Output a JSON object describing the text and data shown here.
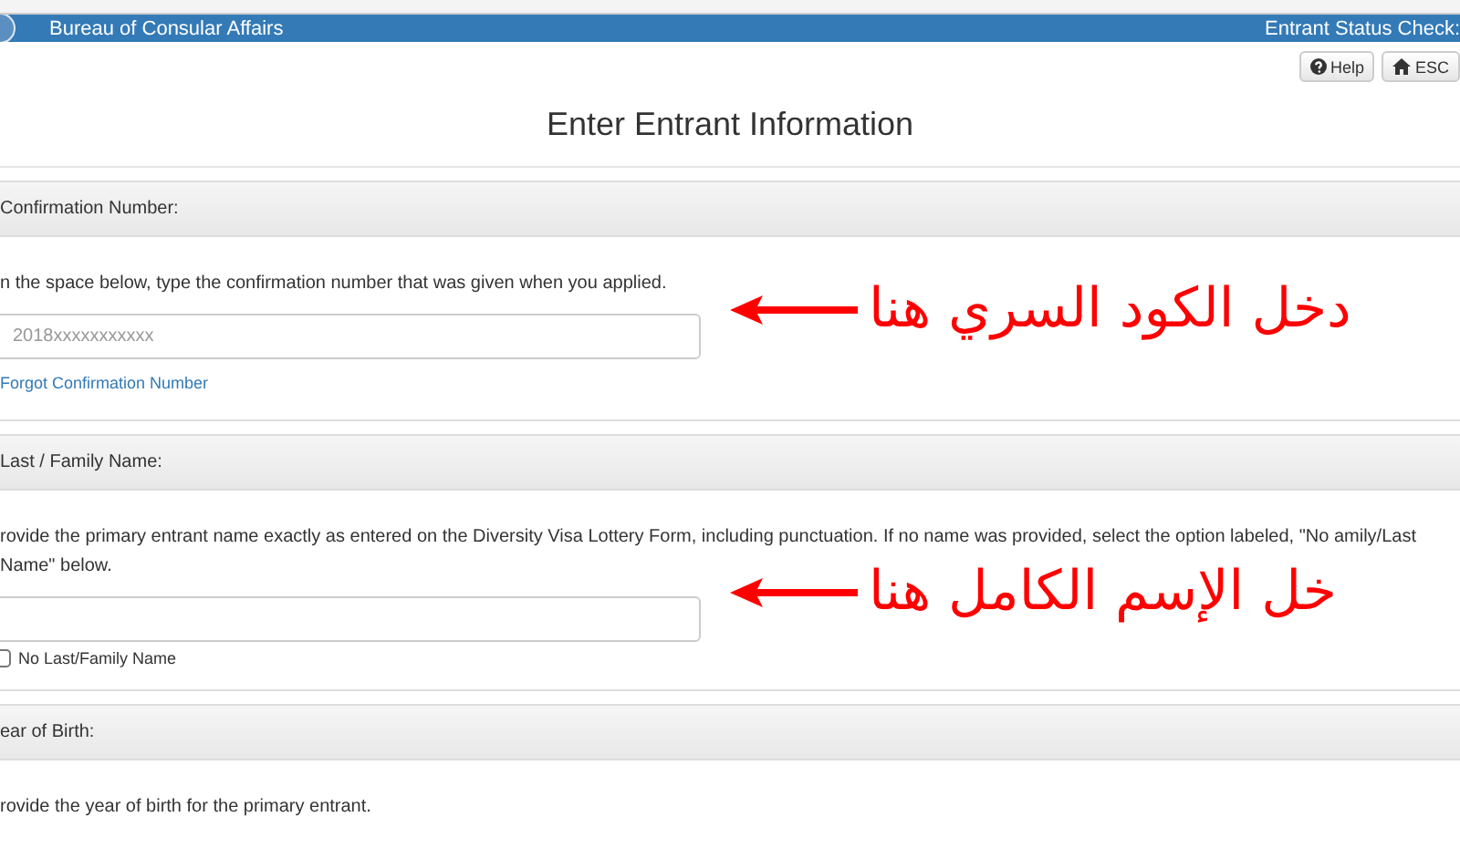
{
  "header": {
    "agency": "Bureau of Consular Affairs",
    "app_title": "Entrant Status Check:"
  },
  "toolbar": [
    {
      "label": "Help"
    },
    {
      "label": "ESC"
    }
  ],
  "page_title": "Enter Entrant Information",
  "sections": [
    {
      "heading": "Confirmation Number:",
      "instructions": "n the space below, type the confirmation number that was given when you applied.",
      "field": {
        "kind": "text",
        "placeholder": "2018xxxxxxxxxxx"
      },
      "link": "Forgot Confirmation Number",
      "annotation": "دخل الكود السري هنا"
    },
    {
      "heading": "Last / Family Name:",
      "instructions": "rovide the primary entrant name exactly as entered on the Diversity Visa Lottery Form, including punctuation. If no name was provided, select the option labeled, \"No amily/Last Name\" below.",
      "field": {
        "kind": "text"
      },
      "checkbox": {
        "label": "No Last/Family Name",
        "checked": false
      },
      "annotation": "خل الإسم الكامل هنا"
    },
    {
      "heading": "ear of Birth:",
      "instructions": "rovide the year of birth for the primary entrant."
    }
  ]
}
